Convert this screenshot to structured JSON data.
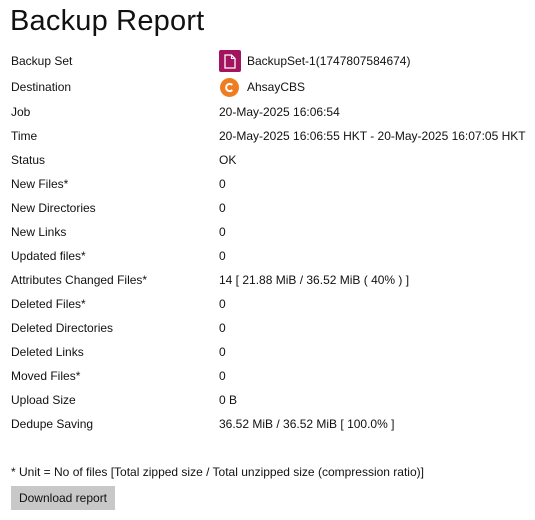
{
  "title": "Backup Report",
  "rows": [
    {
      "label": "Backup Set",
      "value": "BackupSet-1(1747807584674)",
      "icon": "file-icon"
    },
    {
      "label": "Destination",
      "value": "AhsayCBS",
      "icon": "ahsay-cbs-icon"
    },
    {
      "label": "Job",
      "value": "20-May-2025 16:06:54"
    },
    {
      "label": "Time",
      "value": "20-May-2025 16:06:55 HKT - 20-May-2025 16:07:05 HKT"
    },
    {
      "label": "Status",
      "value": "OK"
    },
    {
      "label": "New Files*",
      "value": "0"
    },
    {
      "label": "New Directories",
      "value": "0"
    },
    {
      "label": "New Links",
      "value": "0"
    },
    {
      "label": "Updated files*",
      "value": "0"
    },
    {
      "label": "Attributes Changed Files*",
      "value": "14 [ 21.88 MiB / 36.52 MiB ( 40% ) ]"
    },
    {
      "label": "Deleted Files*",
      "value": "0"
    },
    {
      "label": "Deleted Directories",
      "value": "0"
    },
    {
      "label": "Deleted Links",
      "value": "0"
    },
    {
      "label": "Moved Files*",
      "value": "0"
    },
    {
      "label": "Upload Size",
      "value": "0 B"
    },
    {
      "label": "Dedupe Saving",
      "value": "36.52 MiB / 36.52 MiB [ 100.0% ]"
    }
  ],
  "note": "* Unit = No of files [Total zipped size / Total unzipped size (compression ratio)]",
  "download_button": "Download report",
  "colors": {
    "file_icon_bg": "#a3135e",
    "destination_icon_bg": "#ee7d22",
    "button_bg": "#c8c8c8"
  }
}
